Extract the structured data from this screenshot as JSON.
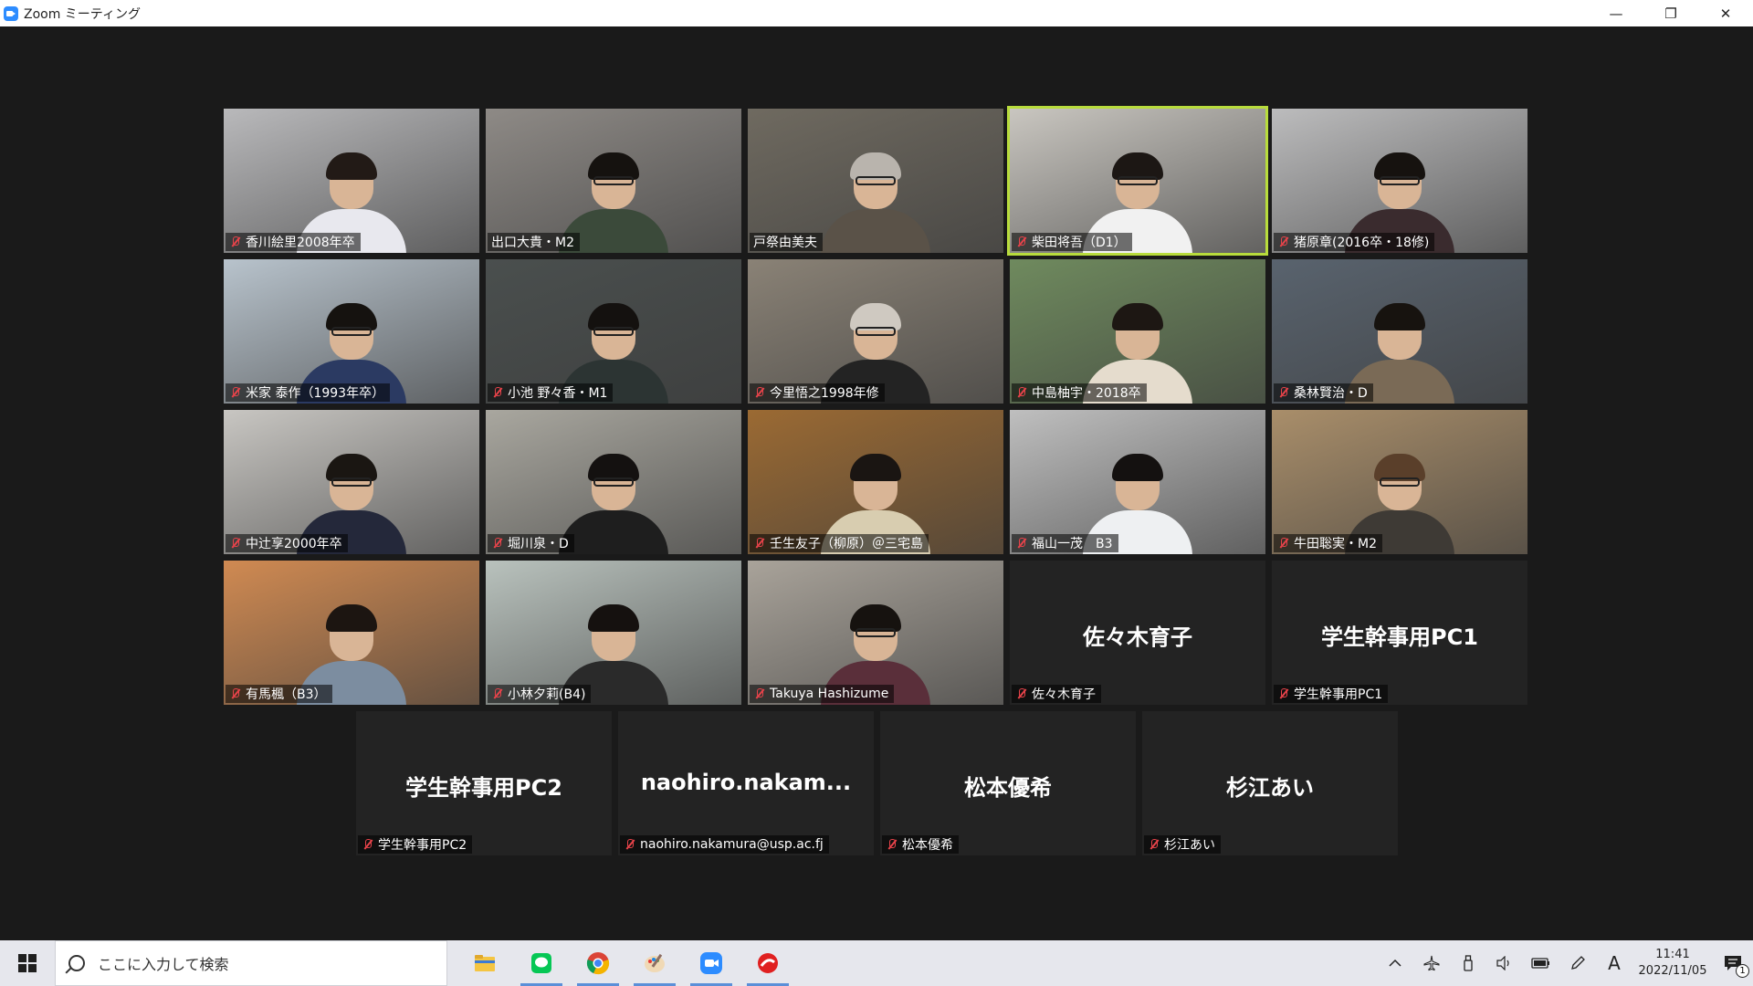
{
  "window": {
    "title": "Zoom ミーティング",
    "minimize": "—",
    "restore": "❐",
    "close": "✕"
  },
  "colors": {
    "meeting_bg": "#1a1a1a",
    "tile_bg": "#232323",
    "active_speaker_outline": "#b8dc3c",
    "muted_icon": "#e8434a",
    "taskbar_bg": "#e6e7ed"
  },
  "participants": [
    {
      "name": "香川絵里2008年卒",
      "muted": true,
      "video": true,
      "scene": "#b9b9bb",
      "shirt": "#e8e8ee",
      "hair": "#221a16",
      "glasses": false
    },
    {
      "name": "出口大貴・M2",
      "muted": false,
      "video": true,
      "scene": "#8e8a86",
      "shirt": "#3b4a3a",
      "hair": "#15120f",
      "glasses": true
    },
    {
      "name": "戸祭由美夫",
      "muted": false,
      "video": true,
      "scene": "#6f6a60",
      "shirt": "#5a5248",
      "hair": "#b9b4ad",
      "glasses": true
    },
    {
      "name": "柴田将吾（D1）",
      "muted": true,
      "video": true,
      "scene": "#c9c6c0",
      "shirt": "#f1f1f1",
      "hair": "#1c1714",
      "glasses": true,
      "active": true
    },
    {
      "name": "猪原章(2016卒・18修)",
      "muted": true,
      "video": true,
      "scene": "#bcbcbd",
      "shirt": "#3a2b2e",
      "hair": "#16120f",
      "glasses": true
    },
    {
      "name": "米家 泰作（1993年卒）",
      "muted": true,
      "video": true,
      "scene": "#b8c3cc",
      "shirt": "#2b3a62",
      "hair": "#15120f",
      "glasses": true
    },
    {
      "name": "小池 野々香・M1",
      "muted": true,
      "video": true,
      "scene": "#4a4f4e",
      "shirt": "#2c3433",
      "hair": "#14110f",
      "glasses": true
    },
    {
      "name": "今里悟之1998年修",
      "muted": true,
      "video": true,
      "scene": "#8a8276",
      "shirt": "#232323",
      "hair": "#cfc9c1",
      "glasses": true
    },
    {
      "name": "中島柚宇・2018卒",
      "muted": true,
      "video": true,
      "scene": "#6f8a5e",
      "shirt": "#e5dccd",
      "hair": "#1d1713",
      "glasses": false
    },
    {
      "name": "桑林賢治・D",
      "muted": true,
      "video": true,
      "scene": "#59636e",
      "shirt": "#7a6a56",
      "hair": "#17130f",
      "glasses": false
    },
    {
      "name": "中辻享2000年卒",
      "muted": true,
      "video": true,
      "scene": "#c8c6c2",
      "shirt": "#24283a",
      "hair": "#1a1612",
      "glasses": true
    },
    {
      "name": "堀川泉・D",
      "muted": true,
      "video": true,
      "scene": "#a9a79f",
      "shirt": "#1e1e1e",
      "hair": "#141110",
      "glasses": true
    },
    {
      "name": "壬生友子（柳原）＠三宅島",
      "muted": true,
      "video": true,
      "scene": "#9b6a33",
      "shirt": "#d8cdb0",
      "hair": "#1a1512",
      "glasses": false
    },
    {
      "name": "福山一茂　B3",
      "muted": true,
      "video": true,
      "scene": "#bfbfbf",
      "shirt": "#eef0f2",
      "hair": "#141110",
      "glasses": false
    },
    {
      "name": "牛田聡実・M2",
      "muted": true,
      "video": true,
      "scene": "#a98e6a",
      "shirt": "#3e3a35",
      "hair": "#5a3f2a",
      "glasses": true
    },
    {
      "name": "有馬楓（B3）",
      "muted": true,
      "video": true,
      "scene": "#d08a52",
      "shirt": "#7c8da0",
      "hair": "#1c1511",
      "glasses": false
    },
    {
      "name": "小林夕莉(B4)",
      "muted": true,
      "video": true,
      "scene": "#b9c2bd",
      "shirt": "#2a2a2a",
      "hair": "#15110f",
      "glasses": false
    },
    {
      "name": "Takuya Hashizume",
      "muted": true,
      "video": true,
      "scene": "#a9a39a",
      "shirt": "#5a2f3a",
      "hair": "#16120f",
      "glasses": true
    },
    {
      "name": "佐々木育子",
      "display": "佐々木育子",
      "muted": true,
      "video": false
    },
    {
      "name": "学生幹事用PC1",
      "display": "学生幹事用PC1",
      "muted": true,
      "video": false
    },
    {
      "name": "学生幹事用PC2",
      "display": "学生幹事用PC2",
      "muted": true,
      "video": false
    },
    {
      "name": "naohiro.nakamura@usp.ac.fj",
      "display": "naohiro.nakam...",
      "muted": true,
      "video": false
    },
    {
      "name": "松本優希",
      "display": "松本優希",
      "muted": true,
      "video": false
    },
    {
      "name": "杉江あい",
      "display": "杉江あい",
      "muted": true,
      "video": false
    }
  ],
  "taskbar": {
    "search_placeholder": "ここに入力して検索",
    "apps": [
      "file-explorer-icon",
      "line-icon",
      "chrome-icon",
      "paint-icon",
      "zoom-icon",
      "app-red-icon"
    ],
    "tray": {
      "ime": "A",
      "time": "11:41",
      "date": "2022/11/05",
      "notifications": "1"
    }
  }
}
